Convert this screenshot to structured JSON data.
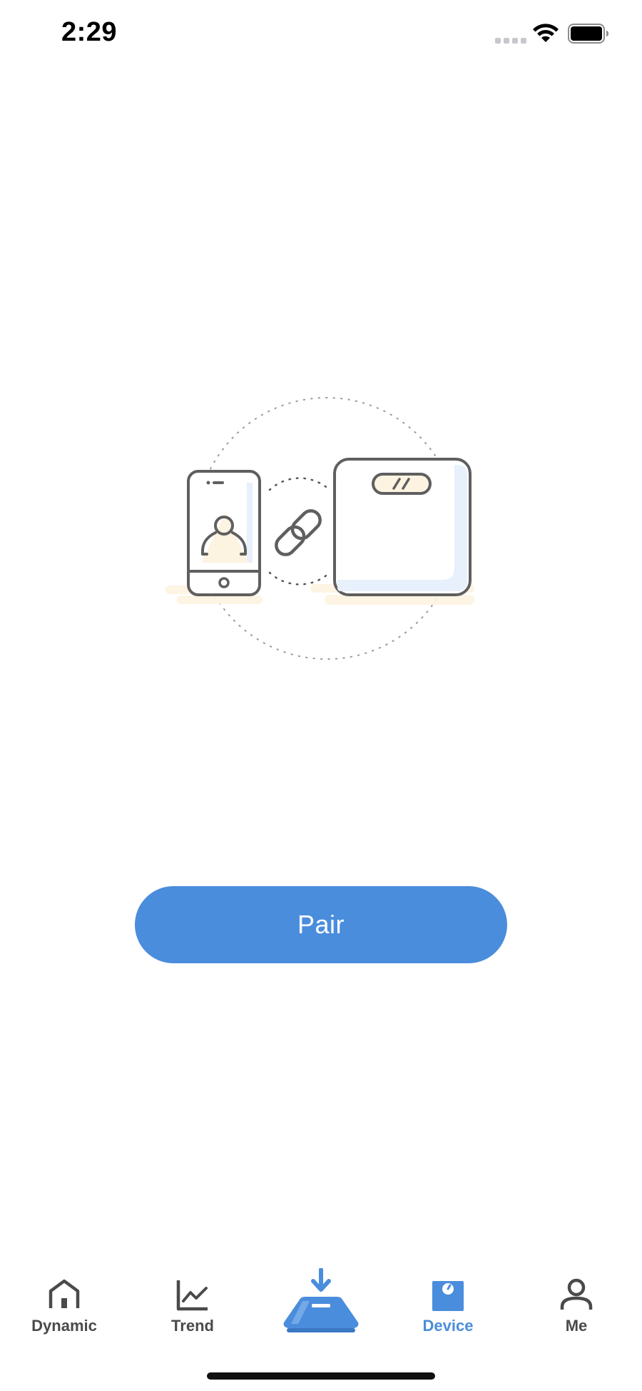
{
  "status_bar": {
    "time": "2:29",
    "icons": [
      "signal-icon",
      "wifi-icon",
      "battery-icon"
    ]
  },
  "illustration": {
    "icons": [
      "phone-icon",
      "user-icon",
      "link-icon",
      "scale-icon"
    ],
    "colors": {
      "stroke": "#5f5f5f",
      "highlight": "#e7f0fb",
      "shadow": "#fdf3e1",
      "dots": "#9a9a9a"
    }
  },
  "pair_button": {
    "label": "Pair"
  },
  "tab_bar": {
    "tabs": [
      {
        "label": "Dynamic",
        "icon": "home-icon",
        "active": false
      },
      {
        "label": "Trend",
        "icon": "trend-chart-icon",
        "active": false
      },
      {
        "label": "",
        "icon": "scale-download-icon",
        "active": false
      },
      {
        "label": "Device",
        "icon": "device-scale-icon",
        "active": true
      },
      {
        "label": "Me",
        "icon": "person-icon",
        "active": false
      }
    ]
  },
  "colors": {
    "accent": "#4a8ddc",
    "tab_inactive": "#4a4a4a",
    "background": "#ffffff"
  }
}
